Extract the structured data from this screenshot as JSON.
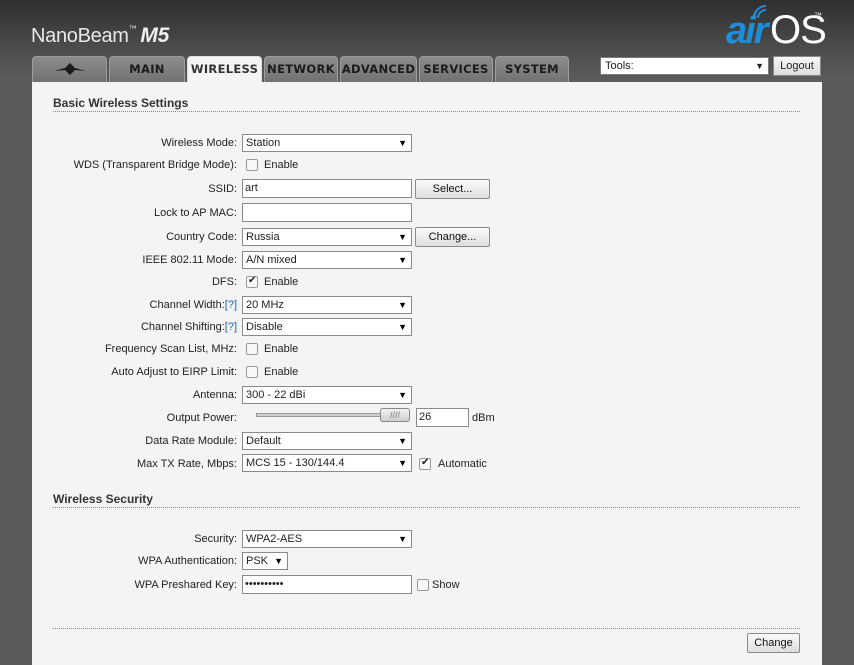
{
  "header": {
    "brand": "NanoBeam",
    "brand_tm": "™",
    "model": "M5",
    "logo_air": "air",
    "logo_os": "OS",
    "logo_tm": "™"
  },
  "tabs": [
    {
      "label": "",
      "icon": "ubiquiti-logo-icon"
    },
    {
      "label": "MAIN"
    },
    {
      "label": "WIRELESS",
      "active": true
    },
    {
      "label": "NETWORK"
    },
    {
      "label": "ADVANCED"
    },
    {
      "label": "SERVICES"
    },
    {
      "label": "SYSTEM"
    }
  ],
  "tools": {
    "value": "Tools:",
    "logout_label": "Logout"
  },
  "basic": {
    "title": "Basic Wireless Settings",
    "wireless_mode": {
      "label": "Wireless Mode:",
      "value": "Station"
    },
    "wds": {
      "label": "WDS (Transparent Bridge Mode):",
      "option": "Enable",
      "checked": false
    },
    "ssid": {
      "label": "SSID:",
      "value": "art",
      "button": "Select..."
    },
    "lock_ap": {
      "label": "Lock to AP MAC:",
      "value": ""
    },
    "country": {
      "label": "Country Code:",
      "value": "Russia",
      "button": "Change..."
    },
    "ieee": {
      "label": "IEEE 802.11 Mode:",
      "value": "A/N mixed"
    },
    "dfs": {
      "label": "DFS:",
      "option": "Enable",
      "checked": true
    },
    "channel_width": {
      "label": "Channel Width:",
      "help": "[?]",
      "value": "20 MHz"
    },
    "channel_shifting": {
      "label": "Channel Shifting:",
      "help": "[?]",
      "value": "Disable"
    },
    "freq_scan": {
      "label": "Frequency Scan List, MHz:",
      "option": "Enable",
      "checked": false
    },
    "eirp": {
      "label": "Auto Adjust to EIRP Limit:",
      "option": "Enable",
      "checked": false
    },
    "antenna": {
      "label": "Antenna:",
      "value": "300 - 22 dBi"
    },
    "output_power": {
      "label": "Output Power:",
      "value": "26",
      "unit": "dBm",
      "level": 0.83
    },
    "data_rate": {
      "label": "Data Rate Module:",
      "value": "Default"
    },
    "max_tx": {
      "label": "Max TX Rate, Mbps:",
      "value": "MCS 15 - 130/144.4",
      "option": "Automatic",
      "checked": true
    }
  },
  "security": {
    "title": "Wireless Security",
    "security": {
      "label": "Security:",
      "value": "WPA2-AES"
    },
    "wpa_auth": {
      "label": "WPA Authentication:",
      "value": "PSK"
    },
    "wpa_key": {
      "label": "WPA Preshared Key:",
      "value": "••••••••••",
      "option": "Show",
      "checked": false
    }
  },
  "change_label": "Change"
}
